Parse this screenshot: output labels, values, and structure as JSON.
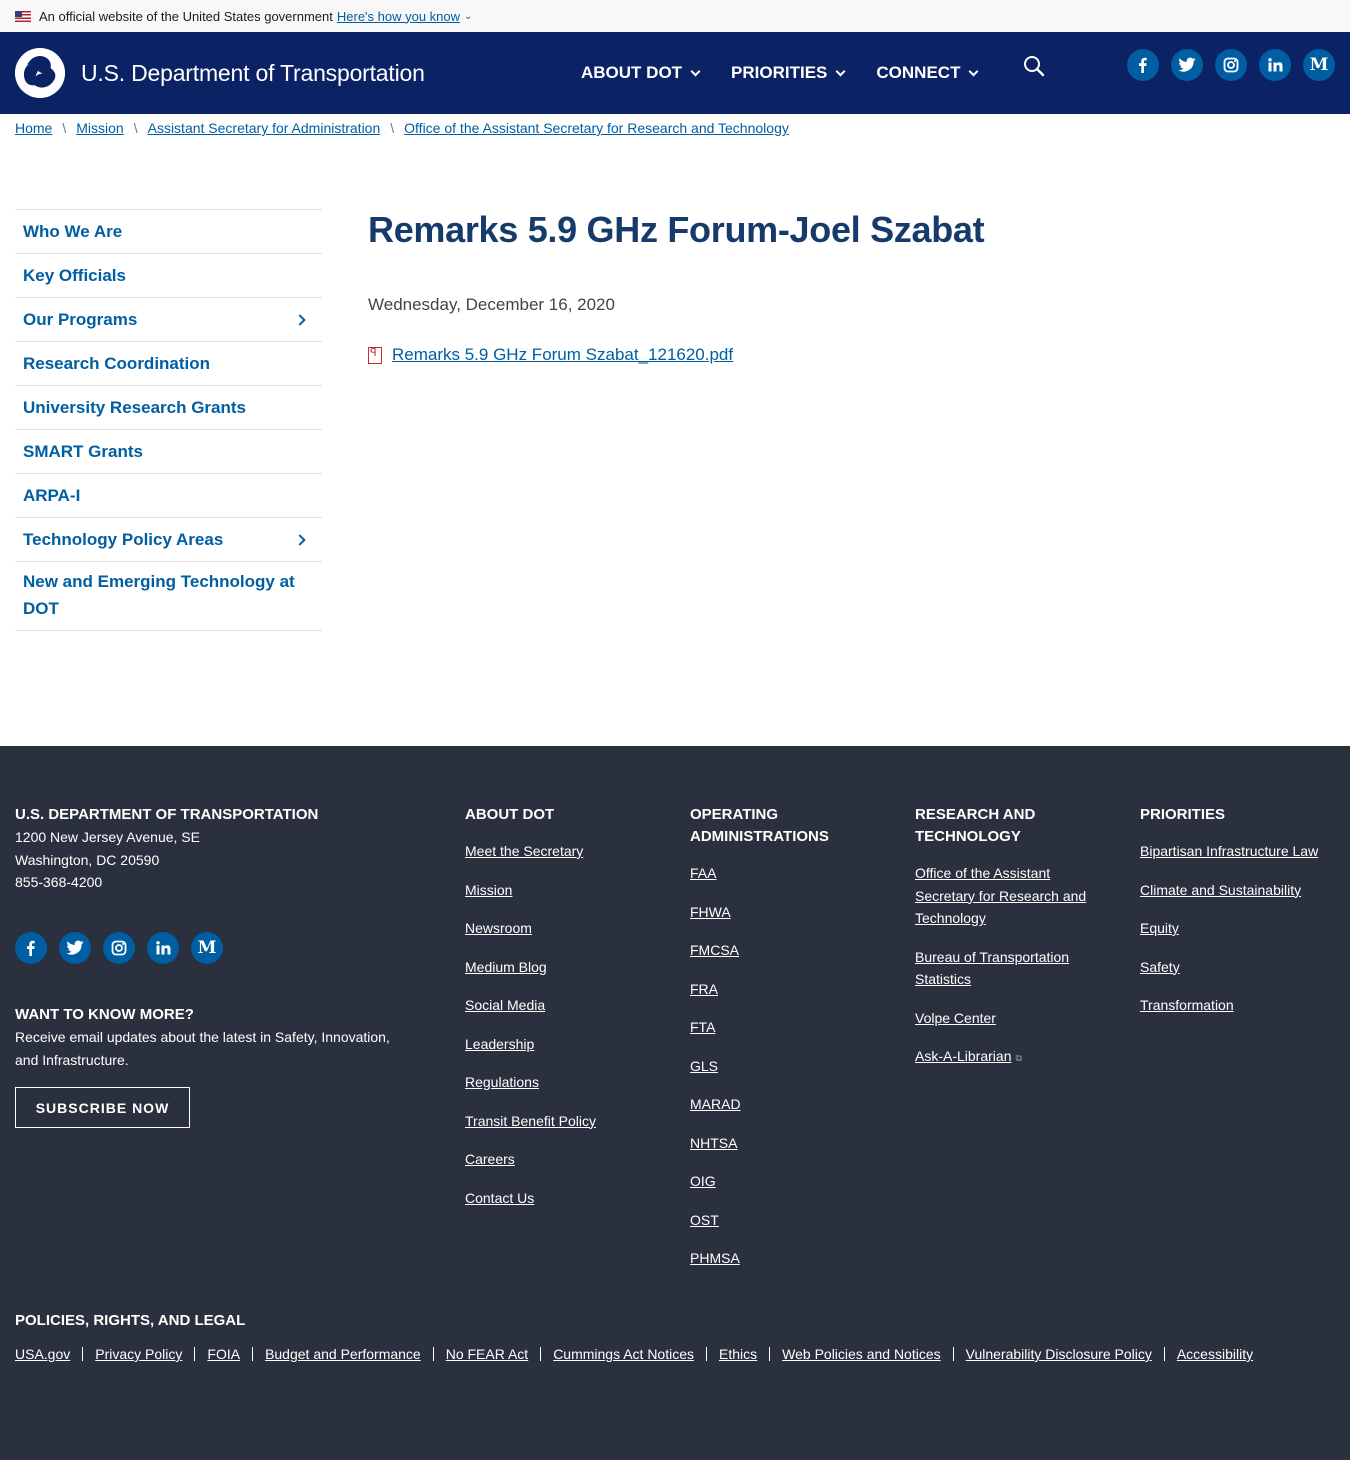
{
  "gov_banner": {
    "text": "An official website of the United States government",
    "link": "Here's how you know"
  },
  "header": {
    "site_name": "U.S. Department of Transportation",
    "nav": [
      "ABOUT DOT",
      "PRIORITIES",
      "CONNECT"
    ],
    "social": [
      "facebook-icon",
      "twitter-icon",
      "instagram-icon",
      "linkedin-icon",
      "medium-icon"
    ],
    "social_labels": [
      "f",
      "t",
      "ig",
      "in",
      "M"
    ]
  },
  "breadcrumb": [
    "Home",
    "Mission",
    "Assistant Secretary for Administration",
    "Office of the Assistant Secretary for Research and Technology"
  ],
  "sidenav": [
    {
      "label": "Who We Are",
      "has_children": false
    },
    {
      "label": "Key Officials",
      "has_children": false
    },
    {
      "label": "Our Programs",
      "has_children": true
    },
    {
      "label": "Research Coordination",
      "has_children": false
    },
    {
      "label": "University Research Grants",
      "has_children": false
    },
    {
      "label": "SMART Grants",
      "has_children": false
    },
    {
      "label": "ARPA-I",
      "has_children": false
    },
    {
      "label": "Technology Policy Areas",
      "has_children": true
    },
    {
      "label": "New and Emerging Technology at DOT",
      "has_children": false
    }
  ],
  "main": {
    "title": "Remarks 5.9 GHz Forum-Joel Szabat",
    "date": "Wednesday, December 16, 2020",
    "file": "Remarks 5.9 GHz Forum Szabat_121620.pdf"
  },
  "footer": {
    "org": {
      "heading": "U.S. DEPARTMENT OF TRANSPORTATION",
      "address1": "1200 New Jersey Avenue, SE",
      "address2": "Washington, DC 20590",
      "phone": "855-368-4200"
    },
    "subscribe": {
      "heading": "WANT TO KNOW MORE?",
      "text": "Receive email updates about the latest in Safety, Innovation, and Infrastructure.",
      "button": "SUBSCRIBE NOW"
    },
    "about": {
      "heading": "ABOUT DOT",
      "links": [
        "Meet the Secretary",
        "Mission",
        "Newsroom",
        "Medium Blog",
        "Social Media",
        "Leadership",
        "Regulations",
        "Transit Benefit Policy",
        "Careers",
        "Contact Us"
      ]
    },
    "operating": {
      "heading": "OPERATING ADMINISTRATIONS",
      "links": [
        "FAA",
        "FHWA",
        "FMCSA",
        "FRA",
        "FTA",
        "GLS",
        "MARAD",
        "NHTSA",
        "OIG",
        "OST",
        "PHMSA"
      ]
    },
    "research": {
      "heading": "RESEARCH AND TECHNOLOGY",
      "links": [
        "Office of the Assistant Secretary for Research and Technology",
        "Bureau of Transportation Statistics",
        "Volpe Center",
        "Ask-A-Librarian"
      ]
    },
    "priorities": {
      "heading": "PRIORITIES",
      "links": [
        "Bipartisan Infrastructure Law",
        "Climate and Sustainability",
        "Equity",
        "Safety",
        "Transformation"
      ]
    },
    "policies": {
      "heading": "POLICIES, RIGHTS, AND LEGAL",
      "links": [
        "USA.gov",
        "Privacy Policy",
        "FOIA",
        "Budget and Performance",
        "No FEAR Act",
        "Cummings Act Notices",
        "Ethics",
        "Web Policies and Notices",
        "Vulnerability Disclosure Policy",
        "Accessibility"
      ]
    }
  }
}
